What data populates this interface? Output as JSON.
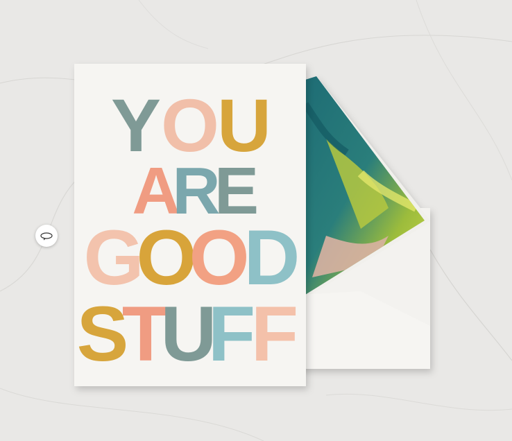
{
  "card": {
    "lines": [
      [
        {
          "ch": "Y",
          "color": "#7f9a96"
        },
        {
          "ch": "O",
          "color": "#f1bfa9"
        },
        {
          "ch": "U",
          "color": "#d7a53c"
        }
      ],
      [
        {
          "ch": "A",
          "color": "#f09c82"
        },
        {
          "ch": "R",
          "color": "#7ba7ad"
        },
        {
          "ch": "E",
          "color": "#7f9a96"
        }
      ],
      [
        {
          "ch": "G",
          "color": "#f3c3ad"
        },
        {
          "ch": "O",
          "color": "#d8a43a"
        },
        {
          "ch": "O",
          "color": "#f2a183"
        },
        {
          "ch": "D",
          "color": "#8ec1c7"
        }
      ],
      [
        {
          "ch": "S",
          "color": "#d7a53c"
        },
        {
          "ch": "T",
          "color": "#f09c82"
        },
        {
          "ch": "U",
          "color": "#7f9a96"
        },
        {
          "ch": "F",
          "color": "#8ec1c7"
        },
        {
          "ch": "F",
          "color": "#f4c1aa"
        }
      ]
    ]
  },
  "colors": {
    "background": "#e9e8e6",
    "card": "#f6f5f2",
    "envelope": "#f3f2ef",
    "liner_teal": "#1f6f77",
    "liner_green": "#b9c840",
    "liner_pink": "#d9b1a2"
  },
  "controls": {
    "rotate_icon": "rotate-360-icon"
  }
}
